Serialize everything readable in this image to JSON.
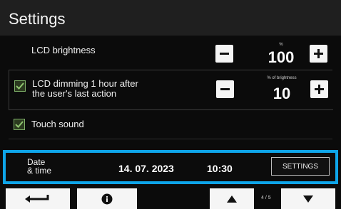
{
  "header": {
    "title": "Settings"
  },
  "settings": {
    "lcd_brightness": {
      "label": "LCD brightness",
      "subtitle": "%",
      "value": "100"
    },
    "lcd_dimming": {
      "label_line1": "LCD dimming 1 hour after",
      "label_line2": "the user's last action",
      "subtitle": "% of brightness",
      "value": "10",
      "checked": true
    },
    "touch_sound": {
      "label": "Touch sound",
      "checked": true
    }
  },
  "datetime": {
    "label_line1": "Date",
    "label_line2": "& time",
    "date": "14. 07. 2023",
    "time": "10:30",
    "button_label": "SETTINGS"
  },
  "bottom_bar": {
    "page_indicator": "4 / 5",
    "icons": [
      "back-icon",
      "info-icon",
      "up-arrow-icon",
      "down-arrow-icon"
    ]
  },
  "colors": {
    "accent": "#0ea5e9",
    "checkbox_green": "#7fb069",
    "background": "#0b0b0b",
    "header": "#1f1f1f"
  }
}
